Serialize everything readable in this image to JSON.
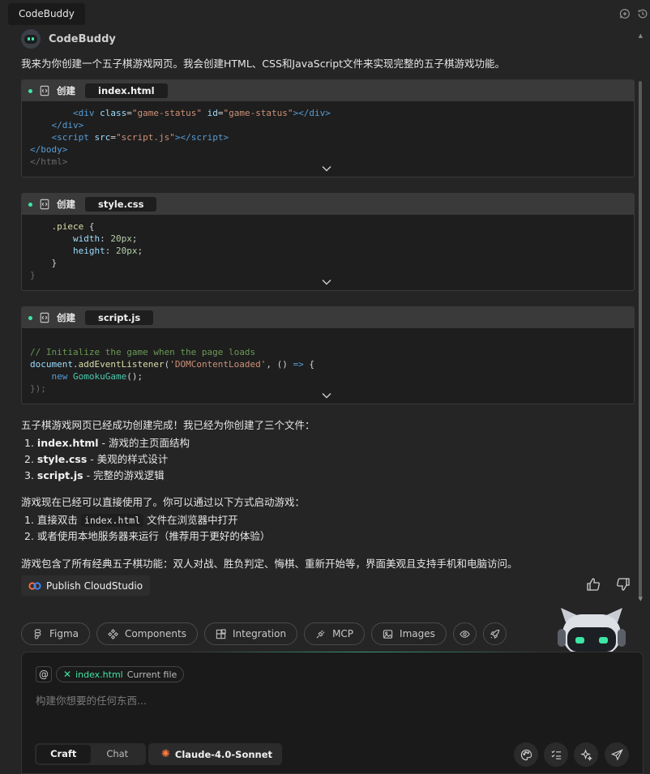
{
  "top": {
    "tab": "CodeBuddy",
    "icons": [
      "new-chat-icon",
      "history-icon"
    ]
  },
  "agent": {
    "name": "CodeBuddy"
  },
  "intro": "我来为你创建一个五子棋游戏网页。我会创建HTML、CSS和JavaScript文件来实现完整的五子棋游戏功能。",
  "cards": [
    {
      "action": "创建",
      "file": "index.html"
    },
    {
      "action": "创建",
      "file": "style.css"
    },
    {
      "action": "创建",
      "file": "script.js"
    }
  ],
  "summary": {
    "done": "五子棋游戏网页已经成功创建完成！我已经为你创建了三个文件：",
    "files": [
      {
        "num": "1.",
        "name": "index.html",
        "desc": " - 游戏的主页面结构"
      },
      {
        "num": "2.",
        "name": "style.css",
        "desc": " - 美观的样式设计"
      },
      {
        "num": "3.",
        "name": "script.js",
        "desc": " - 完整的游戏逻辑"
      }
    ],
    "ready": "游戏现在已经可以直接使用了。你可以通过以下方式启动游戏：",
    "ways": [
      {
        "num": "1.",
        "pre": "直接双击 ",
        "code": "index.html",
        "post": " 文件在浏览器中打开"
      },
      {
        "num": "2.",
        "pre": "或者使用本地服务器来运行（推荐用于更好的体验）",
        "code": "",
        "post": ""
      }
    ],
    "features": "游戏包含了所有经典五子棋功能：双人对战、胜负判定、悔棋、重新开始等，界面美观且支持手机和电脑访问。"
  },
  "publish": {
    "label": "Publish CloudStudio"
  },
  "chips": [
    "Figma",
    "Components",
    "Integration",
    "MCP",
    "Images"
  ],
  "input": {
    "at": "@",
    "context_file": "index.html",
    "context_tag": "Current file",
    "placeholder": "构建你想要的任何东西...",
    "modes": [
      "Craft",
      "Chat"
    ],
    "model": "Claude-4.0-Sonnet"
  },
  "colors": {
    "accent": "#3ee6a5",
    "background": "#252526",
    "card": "#1e1e1e",
    "card_header": "#3a3a3a"
  }
}
